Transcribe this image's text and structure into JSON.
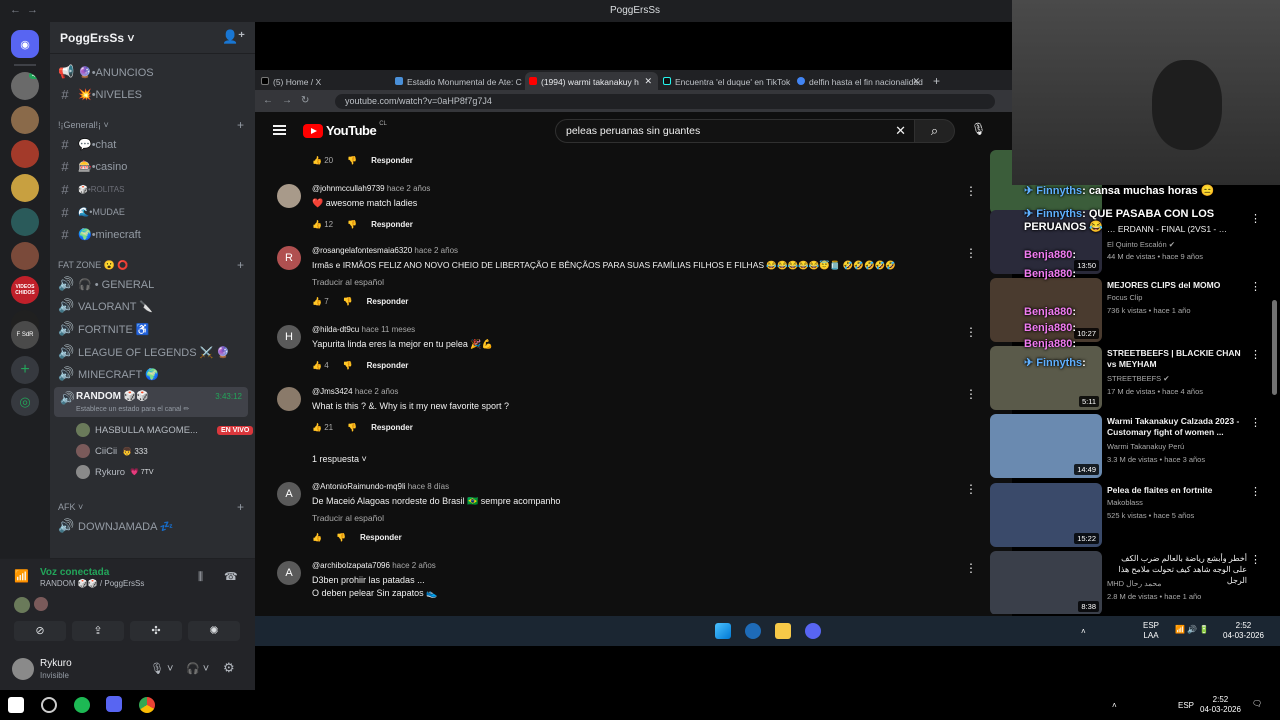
{
  "window": {
    "title": "PoggErsSs"
  },
  "guild": {
    "name": "PoggErsSs"
  },
  "servers": [
    {
      "badge": "4"
    },
    {
      "badge": ""
    },
    {
      "badge": ""
    },
    {
      "badge": ""
    },
    {
      "badge": ""
    },
    {
      "badge": ""
    },
    {
      "label": "VIDEOS CHIDOS"
    },
    {
      "badge": ""
    },
    {
      "label": "F SdR"
    }
  ],
  "channels_top": [
    {
      "symbol": "📢",
      "name": "🔮•ANUNCIOS"
    },
    {
      "symbol": "#",
      "name": "💥•NIVELES"
    }
  ],
  "category_general": "!¡Generalǃ¡",
  "channels_general": [
    {
      "symbol": "#",
      "name": "💬•chat"
    },
    {
      "symbol": "#",
      "name": "🎰•casino"
    },
    {
      "symbol": "#",
      "name": "🎲•ROLITAS"
    },
    {
      "symbol": "#",
      "name": "🌊•MUDAE"
    },
    {
      "symbol": "#",
      "name": "🌍•minecraft"
    }
  ],
  "category_fatzone": "FAT ZONE 😮 ⭕",
  "channels_voice": [
    {
      "symbol": "🔊",
      "name": "🎧 • GENERAL"
    },
    {
      "symbol": "🔊",
      "name": "VALORANT 🔪"
    },
    {
      "symbol": "🔊",
      "name": "FORTNITE ♿"
    },
    {
      "symbol": "🔊",
      "name": "LEAGUE OF LEGENDS ⚔️ 🔮"
    },
    {
      "symbol": "🔊",
      "name": "MINECRAFT 🌍"
    }
  ],
  "active_voice": {
    "name": "RANDOM 🎲🎲",
    "time": "3:43:12",
    "status": "Establece un estado para el canal ✏"
  },
  "voice_users": [
    {
      "name": "HASBULLA MAGOME...",
      "tag": "EN VIVO"
    },
    {
      "name": "CiiCii",
      "tag": "👦 333"
    },
    {
      "name": "Rykuro",
      "tag": "💗 7TV"
    }
  ],
  "category_afk": "AFK",
  "channel_afk": {
    "symbol": "🔊",
    "name": "DOWNJAMADA 💤"
  },
  "voice_panel": {
    "status": "Voz conectada",
    "channel": "RANDOM 🎲🎲 / PoggErsSs"
  },
  "user": {
    "name": "Rykuro",
    "status": "Invisible"
  },
  "tabs": [
    {
      "label": "(5) Home / X",
      "color": "#000000"
    },
    {
      "label": "Estadio Monumental de Ate: C",
      "color": "#4a90d9"
    },
    {
      "label": "(1994) warmi takanakuy h",
      "color": "#ff0000"
    },
    {
      "label": "Encuentra 'el duque' en TikTok",
      "color": "#111111"
    },
    {
      "label": "delfin hasta el fin nacionalidad",
      "color": "#4285f4"
    }
  ],
  "url": "youtube.com/watch?v=0aHP8f7g7J4",
  "youtube": {
    "brand": "YouTube",
    "country": "CL",
    "search": "peleas peruanas sin guantes"
  },
  "comments": [
    {
      "top_likes": "20",
      "reply": "Responder"
    },
    {
      "user": "@johnmccullah9739",
      "time": "hace 2 años",
      "text": "❤️ awesome match ladies",
      "likes": "12",
      "initial": ""
    },
    {
      "user": "@rosangelafontesmaia6320",
      "time": "hace 2 años",
      "text": "Irmãs e  IRMÃOS  FELIZ  ANO NOVO  CHEIO DE  LIBERTAÇÃO  E BÊNÇÃOS  PARA SUAS FAMÍLIAS  FILHOS E FILHAS 😂😂😂😂😂😇🫙 🤣🤣🤣🤣🤣",
      "translate": "Traducir al español",
      "likes": "7",
      "initial": "R"
    },
    {
      "user": "@hilda-dt9cu",
      "time": "hace 11 meses",
      "text": "Yapurita linda eres la mejor en tu pelea 🎉💪",
      "likes": "4",
      "initial": "H"
    },
    {
      "user": "@Jms3424",
      "time": "hace 2 años",
      "text": "What is this ? &. Why is it my new favorite sport ?",
      "likes": "21",
      "initial": "",
      "replies": "1 respuesta"
    },
    {
      "user": "@AntonioRaimundo-mq9li",
      "time": "hace 8 días",
      "text": "De Maceió Alagoas nordeste do Brasil 🇧🇷 sempre acompanho",
      "translate": "Traducir al español",
      "likes": "",
      "initial": "A"
    },
    {
      "user": "@archibolzapata7096",
      "time": "hace 2 años",
      "text": "D3ben prohiir las patadas ...",
      "text2": "O deben pelear Sin zapatos 👟",
      "initial": "A"
    }
  ],
  "videos": [
    {
      "title": "",
      "channel": "",
      "meta": "",
      "duration": "",
      "color": "#3b5d3a"
    },
    {
      "title": "… ERDANN - FINAL (2VS1 - …",
      "channel": "El Quinto Escalón ✔",
      "meta": "44 M de vistas • hace 9 años",
      "duration": "13:50",
      "color": "#2a2a3a"
    },
    {
      "title": "MEJORES CLIPS del MOMO",
      "channel": "Focus Clip",
      "meta": "736 k vistas • hace 1 año",
      "duration": "10:27",
      "color": "#4a3b2f"
    },
    {
      "title": "STREETBEEFS | BLACKIE CHAN vs MEYHAM",
      "channel": "STREETBEEFS ✔",
      "meta": "17 M de vistas • hace 4 años",
      "duration": "5:11",
      "color": "#5a5a4a"
    },
    {
      "title": "Warmi Takanakuy Calzada 2023 - Customary fight of women ...",
      "channel": "Warmi Takanakuy Perú",
      "meta": "3.3 M de vistas • hace 3 años",
      "duration": "14:49",
      "color": "#6a8ab0"
    },
    {
      "title": "Pelea de flaites en fortnite",
      "channel": "Makoblass",
      "meta": "525 k vistas • hace 5 años",
      "duration": "15:22",
      "color": "#3a4a6a"
    },
    {
      "title": "أخطر وأبشع رياضة بالعالم ضرب الكف على الوجه شاهد كيف تحولت ملامح هذا الرجل",
      "channel": "MHD محمد رحال",
      "meta": "2.8 M de vistas • hace 1 año",
      "duration": "8:38",
      "color": "#3a3f4a"
    }
  ],
  "overlay_chat": [
    {
      "user": "✈ Finnyths",
      "msg": ": cansa muchas horas 😑"
    },
    {
      "user": "✈ Finnyths",
      "msg": ": QUE PASABA CON LOS PERUANOS 😂"
    },
    {
      "user": "Benja880",
      "msg": ":"
    },
    {
      "user": "Benja880",
      "msg": ":"
    },
    {
      "user": "Benja880",
      "msg": ":"
    },
    {
      "user": "Benja880",
      "msg": ":"
    },
    {
      "user": "Benja880",
      "msg": ":"
    },
    {
      "user": "✈ Finnyths",
      "msg": ":"
    }
  ],
  "taskbar_inner": {
    "lang": "ESP",
    "lang2": "LAA",
    "time": "2:52",
    "date": "04-03-2026"
  },
  "taskbar_outer": {
    "lang": "ESP",
    "time": "2:52",
    "date": "04-03-2026"
  }
}
